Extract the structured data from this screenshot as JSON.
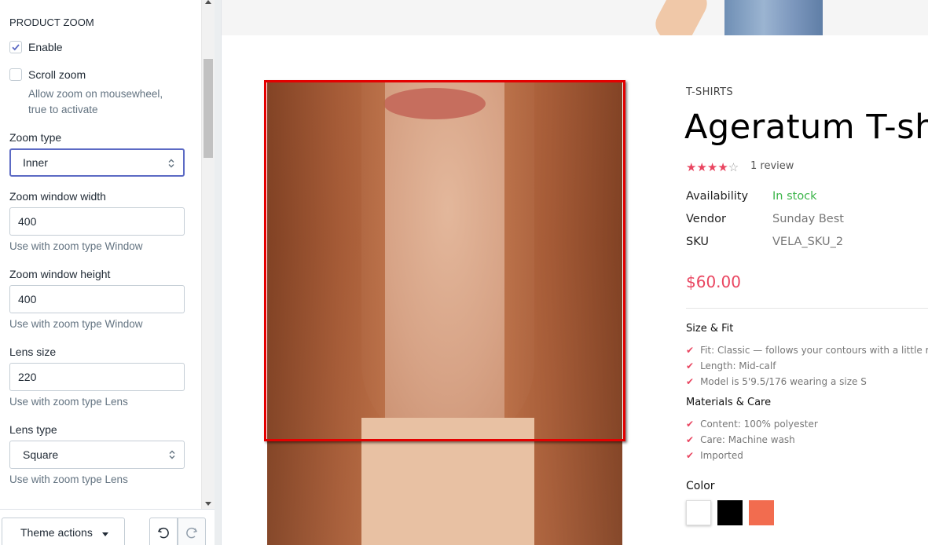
{
  "settings": {
    "section_title": "PRODUCT ZOOM",
    "enable": {
      "label": "Enable",
      "checked": true
    },
    "scroll_zoom": {
      "label": "Scroll zoom",
      "checked": false,
      "hint_line1": "Allow zoom on mousewheel,",
      "hint_line2": "true to activate"
    },
    "zoom_type": {
      "label": "Zoom type",
      "value": "Inner"
    },
    "zoom_window_width": {
      "label": "Zoom window width",
      "value": "400",
      "hint": "Use with zoom type Window"
    },
    "zoom_window_height": {
      "label": "Zoom window height",
      "value": "400",
      "hint": "Use with zoom type Window"
    },
    "lens_size": {
      "label": "Lens size",
      "value": "220",
      "hint": "Use with zoom type Lens"
    },
    "lens_type": {
      "label": "Lens type",
      "value": "Square",
      "hint": "Use with zoom type Lens"
    }
  },
  "footer": {
    "theme_actions_label": "Theme actions",
    "undo_icon": "undo-icon",
    "redo_icon": "redo-icon"
  },
  "product": {
    "category": "T-SHIRTS",
    "title": "Ageratum T-sh",
    "rating_stars": "★★★★",
    "rating_empty_star": "☆",
    "rating": 4,
    "rating_max": 5,
    "review_count": "1 review",
    "availability_label": "Availability",
    "availability_value": "In stock",
    "vendor_label": "Vendor",
    "vendor_value": "Sunday Best",
    "sku_label": "SKU",
    "sku_value": "VELA_SKU_2",
    "price": "$60.00",
    "size_fit_heading": "Size & Fit",
    "size_fit_items": [
      "Fit: Classic — follows your contours with a little roo",
      "Length: Mid-calf",
      "Model is 5'9.5/176 wearing a size S"
    ],
    "materials_heading": "Materials & Care",
    "materials_items": [
      "Content: 100% polyester",
      "Care: Machine wash",
      "Imported"
    ],
    "color_label": "Color",
    "colors": [
      "#ffffff",
      "#000000",
      "#f26c4f"
    ]
  },
  "colors": {
    "accent": "#5c6ac4",
    "price_red": "#e94560",
    "stock_green": "#3cb54a",
    "zoom_frame": "#e40000"
  }
}
